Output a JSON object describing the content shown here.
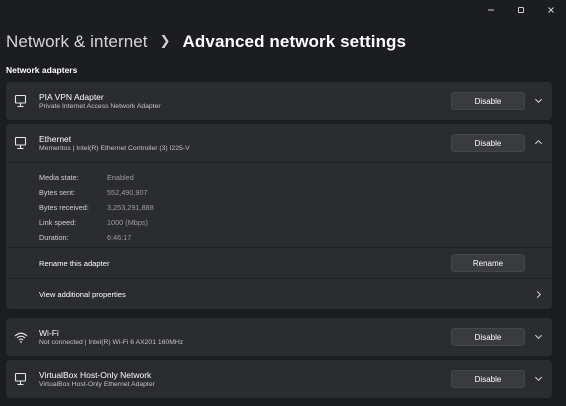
{
  "window": {
    "caption_buttons": [
      "minimize-icon",
      "maximize-icon",
      "close-icon"
    ]
  },
  "header": {
    "parent": "Network & internet",
    "current": "Advanced network settings"
  },
  "section": {
    "label": "Network adapters"
  },
  "adapters": [
    {
      "icon": "ethernet-icon",
      "name": "PIA VPN Adapter",
      "description": "Private Internet Access Network Adapter",
      "button": "Disable",
      "expanded": false
    },
    {
      "icon": "ethernet-icon",
      "name": "Ethernet",
      "description": "Mementos | Intel(R) Ethernet Controller (3) I225-V",
      "button": "Disable",
      "expanded": true,
      "details": [
        {
          "label": "Media state:",
          "value": "Enabled"
        },
        {
          "label": "Bytes sent:",
          "value": "552,490,907"
        },
        {
          "label": "Bytes received:",
          "value": "3,253,291,888"
        },
        {
          "label": "Link speed:",
          "value": "1000 (Mbps)"
        },
        {
          "label": "Duration:",
          "value": "6:46:17"
        }
      ],
      "rename_label": "Rename this adapter",
      "rename_button": "Rename",
      "additional_label": "View additional properties"
    },
    {
      "icon": "wifi-icon",
      "name": "Wi-Fi",
      "description": "Not connected | Intel(R) Wi-Fi 6 AX201 160MHz",
      "button": "Disable",
      "expanded": false
    },
    {
      "icon": "ethernet-icon",
      "name": "VirtualBox Host-Only Network",
      "description": "VirtualBox Host-Only Ethernet Adapter",
      "button": "Disable",
      "expanded": false
    }
  ]
}
